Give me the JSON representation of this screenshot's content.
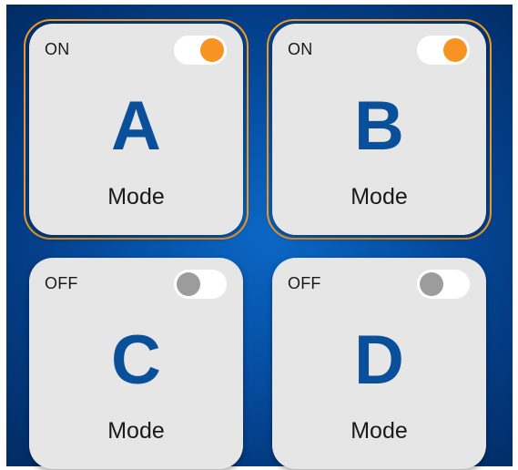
{
  "colors": {
    "accent": "#f39a21",
    "letter": "#0a4f99",
    "knob_on": "#f79320",
    "knob_off": "#9c9c9c",
    "tile_bg": "#e6e6e6",
    "panel_bg": "#0650a6"
  },
  "tiles": [
    {
      "status": "ON",
      "letter": "A",
      "mode": "Mode",
      "enabled": true
    },
    {
      "status": "ON",
      "letter": "B",
      "mode": "Mode",
      "enabled": true
    },
    {
      "status": "OFF",
      "letter": "C",
      "mode": "Mode",
      "enabled": false
    },
    {
      "status": "OFF",
      "letter": "D",
      "mode": "Mode",
      "enabled": false
    }
  ]
}
